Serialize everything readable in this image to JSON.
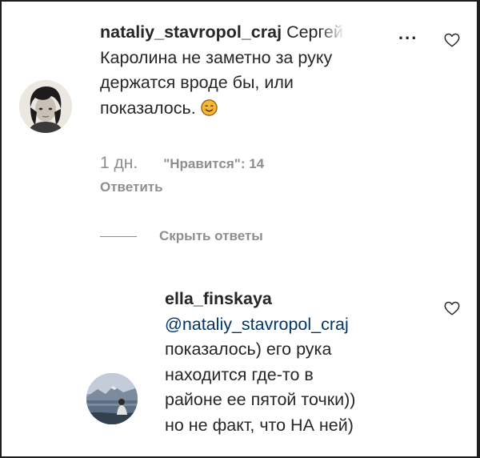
{
  "comment": {
    "username": "nataliy_stavropol_craj",
    "text_head": "Сергей и",
    "lines": [
      "Каролина не заметно за руку",
      "держатся вроде бы, или",
      "показалось."
    ],
    "emoji": "slightly-smiling-face-emoji",
    "time": "1 дн.",
    "likes": "\"Нравится\": 14",
    "reply_label": "Ответить",
    "more_indicator": "..."
  },
  "replies_toggle": {
    "label": "Скрыть ответы"
  },
  "reply": {
    "username": "ella_finskaya",
    "mention": "@nataliy_stavropol_craj",
    "lines": [
      "показалось) его рука",
      "находится где-то в",
      "районе ее пятой точки))",
      "но не факт, что НА ней)"
    ]
  },
  "colors": {
    "text": "#262626",
    "secondary": "#8e8e8e",
    "mention": "#003569",
    "emoji": "#f5a623"
  }
}
